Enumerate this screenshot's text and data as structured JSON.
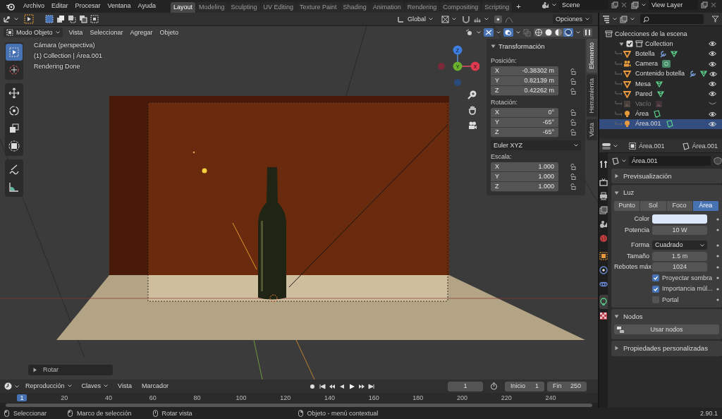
{
  "menu": [
    "Archivo",
    "Editar",
    "Procesar",
    "Ventana",
    "Ayuda"
  ],
  "workspace_tabs": [
    {
      "label": "Layout",
      "selected": true
    },
    {
      "label": "Modeling",
      "selected": false
    },
    {
      "label": "Sculpting",
      "selected": false
    },
    {
      "label": "UV Editing",
      "selected": false
    },
    {
      "label": "Texture Paint",
      "selected": false
    },
    {
      "label": "Shading",
      "selected": false
    },
    {
      "label": "Animation",
      "selected": false
    },
    {
      "label": "Rendering",
      "selected": false
    },
    {
      "label": "Compositing",
      "selected": false
    },
    {
      "label": "Scripting",
      "selected": false
    }
  ],
  "add_tab": "+",
  "scene": "Scene",
  "view_layer": "View Layer",
  "tool_header": {
    "orientation": "Global",
    "options": "Opciones"
  },
  "viewport_header": {
    "mode": "Modo Objeto",
    "menus": [
      "Vista",
      "Seleccionar",
      "Agregar",
      "Objeto"
    ],
    "shading_modes": [
      {
        "kind": "wireframe",
        "selected": false
      },
      {
        "kind": "solid",
        "selected": false
      },
      {
        "kind": "material",
        "selected": false
      },
      {
        "kind": "rendered",
        "selected": true
      }
    ]
  },
  "toolbar": [
    [
      {
        "kind": "select",
        "selected": true
      },
      {
        "kind": "cursor",
        "selected": false
      }
    ],
    [
      {
        "kind": "move",
        "selected": false
      },
      {
        "kind": "rotate",
        "selected": false
      },
      {
        "kind": "scale",
        "selected": false
      },
      {
        "kind": "transform",
        "selected": false
      }
    ],
    [
      {
        "kind": "annotate",
        "selected": false
      },
      {
        "kind": "measure",
        "selected": false
      }
    ]
  ],
  "viewport_info": [
    "Cámara (perspectiva)",
    "(1) Collection | Área.001",
    "Rendering Done"
  ],
  "gizmo_axes": [
    "Z",
    "Y",
    "X"
  ],
  "transform_panel": {
    "title": "Transformación",
    "groups": [
      {
        "label": "Posición:",
        "fields": [
          {
            "axis": "X",
            "value": "-0.38302 m"
          },
          {
            "axis": "Y",
            "value": "0.82139 m"
          },
          {
            "axis": "Z",
            "value": "0.42262 m"
          }
        ]
      },
      {
        "label": "Rotación:",
        "fields": [
          {
            "axis": "X",
            "value": "0°"
          },
          {
            "axis": "Y",
            "value": "-65°"
          },
          {
            "axis": "Z",
            "value": "-65°"
          }
        ],
        "mode": "Euler XYZ"
      },
      {
        "label": "Escala:",
        "fields": [
          {
            "axis": "X",
            "value": "1.000"
          },
          {
            "axis": "Y",
            "value": "1.000"
          },
          {
            "axis": "Z",
            "value": "1.000"
          }
        ]
      }
    ]
  },
  "sidebar_tabs": [
    {
      "label": "Elemento",
      "selected": true
    },
    {
      "label": "Herramienta",
      "selected": false
    },
    {
      "label": "Vista",
      "selected": false
    }
  ],
  "last_operation": {
    "label": "Rotar",
    "expanded": false
  },
  "outliner": {
    "title": "Colecciones de la escena",
    "items": [
      {
        "name": "Collection",
        "kind": "collection",
        "checked": true,
        "expanded": true,
        "visible": true,
        "selected": false,
        "children": [
          {
            "name": "Botella",
            "kind": "mesh",
            "visible": true,
            "selected": false,
            "modifier": true
          },
          {
            "name": "Camera",
            "kind": "camera",
            "visible": true,
            "selected": false,
            "modifier": false
          },
          {
            "name": "Contenido botella",
            "kind": "mesh",
            "visible": true,
            "selected": false,
            "modifier": true
          },
          {
            "name": "Mesa",
            "kind": "mesh",
            "visible": true,
            "selected": false,
            "modifier": false
          },
          {
            "name": "Pared",
            "kind": "mesh",
            "visible": true,
            "selected": false,
            "modifier": false
          },
          {
            "name": "Vacío",
            "kind": "empty",
            "visible": false,
            "selected": false,
            "modifier": false
          },
          {
            "name": "Área",
            "kind": "light",
            "visible": true,
            "selected": false,
            "modifier": false
          },
          {
            "name": "Área.001",
            "kind": "light",
            "visible": true,
            "selected": true,
            "modifier": false
          }
        ]
      }
    ]
  },
  "properties": {
    "breadcrumb": [
      "Área.001",
      "Área.001"
    ],
    "datablock": "Área.001",
    "tabs": [
      {
        "kind": "tool",
        "selected": false
      },
      {
        "kind": "render",
        "selected": false
      },
      {
        "kind": "output",
        "selected": false
      },
      {
        "kind": "view_layer",
        "selected": false
      },
      {
        "kind": "scene",
        "selected": false
      },
      {
        "kind": "world",
        "selected": false
      },
      {
        "kind": "object",
        "selected": false
      },
      {
        "kind": "physics",
        "selected": false
      },
      {
        "kind": "constraints",
        "selected": false
      },
      {
        "kind": "light",
        "selected": true
      },
      {
        "kind": "texture",
        "selected": false
      }
    ],
    "panels": [
      {
        "title": "Previsualización",
        "expanded": false
      },
      {
        "title": "Luz",
        "expanded": true,
        "light_types": [
          {
            "label": "Punto",
            "selected": false
          },
          {
            "label": "Sol",
            "selected": false
          },
          {
            "label": "Foco",
            "selected": false
          },
          {
            "label": "Área",
            "selected": true
          }
        ],
        "rows": [
          {
            "kind": "color",
            "label": "Color",
            "color": "#dde7fa"
          },
          {
            "kind": "number",
            "label": "Potencia",
            "value": "10 W"
          },
          {
            "kind": "dropdown",
            "label": "Forma",
            "value": "Cuadrado"
          },
          {
            "kind": "number",
            "label": "Tamaño",
            "value": "1.5 m"
          },
          {
            "kind": "number",
            "label": "Rebotes máx",
            "value": "1024"
          },
          {
            "kind": "checkbox",
            "label": "Proyectar sombra",
            "checked": true
          },
          {
            "kind": "checkbox",
            "label": "Importancia múl...",
            "checked": true
          },
          {
            "kind": "checkbox",
            "label": "Portal",
            "checked": false
          }
        ]
      },
      {
        "title": "Nodos",
        "expanded": true,
        "button": "Usar nodos"
      },
      {
        "title": "Propiedades personalizadas",
        "expanded": false
      }
    ]
  },
  "timeline": {
    "menus": [
      {
        "label": "Reproducción",
        "dropdown": true
      },
      {
        "label": "Claves",
        "dropdown": true
      },
      {
        "label": "Vista",
        "dropdown": false
      },
      {
        "label": "Marcador",
        "dropdown": false
      }
    ],
    "current_frame": "1",
    "start_label": "Inicio",
    "start": "1",
    "end_label": "Fin",
    "end": "250",
    "frame_marker": "1",
    "ticks": [
      "20",
      "40",
      "60",
      "80",
      "100",
      "120",
      "140",
      "160",
      "180",
      "200",
      "220",
      "240"
    ]
  },
  "status_bar": {
    "hints": [
      "Seleccionar",
      "Marco de selección",
      "Rotar vista",
      "Objeto - menú contextual"
    ],
    "version": "2.90.1"
  }
}
